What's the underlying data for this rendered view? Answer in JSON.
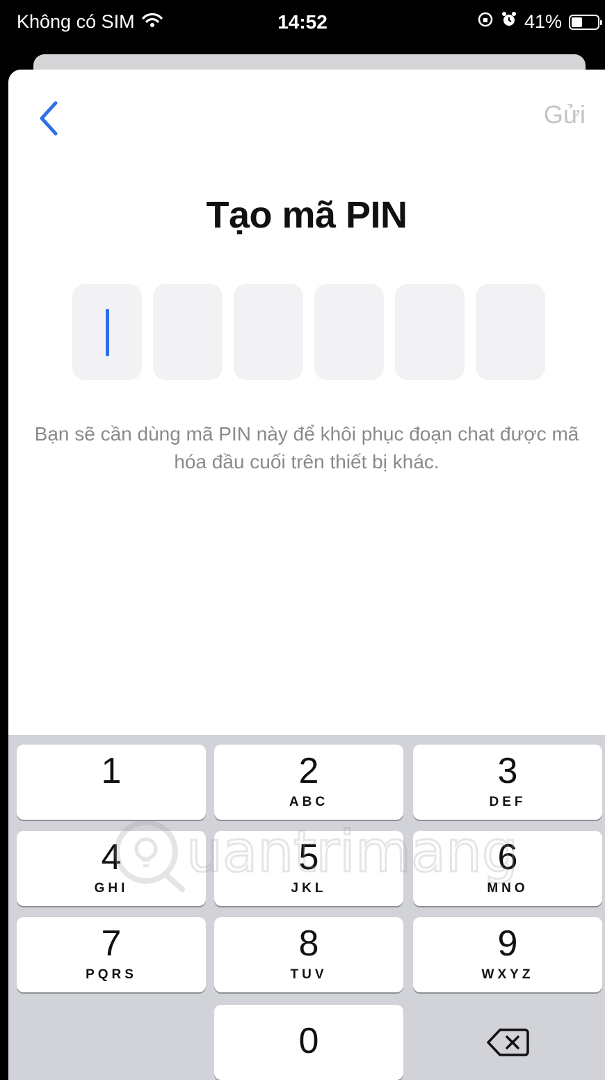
{
  "status_bar": {
    "carrier": "Không có SIM",
    "time": "14:52",
    "battery": "41%",
    "battery_level": 0.41,
    "icons": [
      "wifi-icon",
      "orientation-lock-icon",
      "alarm-icon",
      "battery-icon"
    ]
  },
  "nav": {
    "back_icon": "chevron-left-icon",
    "send_label": "Gửi"
  },
  "title": "Tạo mã PIN",
  "pin": {
    "length": 6,
    "entered": ""
  },
  "hint": "Bạn sẽ cần dùng mã PIN này để khôi phục đoạn chat được mã hóa đầu cuối trên thiết bị khác.",
  "keypad": {
    "keys": [
      {
        "digit": "1",
        "letters": ""
      },
      {
        "digit": "2",
        "letters": "ABC"
      },
      {
        "digit": "3",
        "letters": "DEF"
      },
      {
        "digit": "4",
        "letters": "GHI"
      },
      {
        "digit": "5",
        "letters": "JKL"
      },
      {
        "digit": "6",
        "letters": "MNO"
      },
      {
        "digit": "7",
        "letters": "PQRS"
      },
      {
        "digit": "8",
        "letters": "TUV"
      },
      {
        "digit": "9",
        "letters": "WXYZ"
      },
      {
        "digit": "0",
        "letters": ""
      }
    ],
    "delete_icon": "backspace-icon"
  },
  "watermark": "Quantrimang",
  "colors": {
    "accent": "#2f6ee6",
    "disabled_text": "#c4c4c6",
    "pin_box": "#f2f2f4",
    "keypad_bg": "#d1d3d9"
  }
}
